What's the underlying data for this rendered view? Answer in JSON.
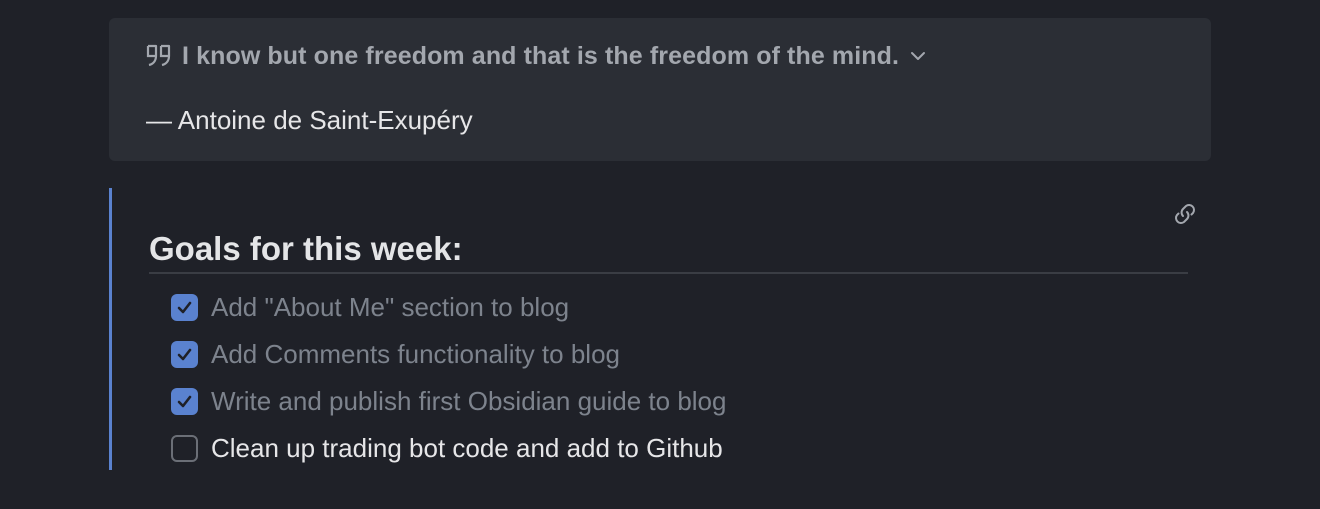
{
  "quote": {
    "icon": "quote-icon",
    "text": "I know but one freedom and that is the freedom of the mind.",
    "author": "— Antoine de Saint-Exupéry"
  },
  "goals": {
    "heading": "Goals for this week:",
    "tasks": [
      {
        "label": "Add \"About Me\" section to blog",
        "checked": true
      },
      {
        "label": "Add Comments functionality to blog",
        "checked": true
      },
      {
        "label": "Write and publish first Obsidian guide to blog",
        "checked": true
      },
      {
        "label": "Clean up trading bot code and add to Github",
        "checked": false
      }
    ]
  },
  "colors": {
    "background": "#1f2128",
    "callout_bg": "#2b2e35",
    "accent": "#5a82cf",
    "done_text": "#7d838d"
  }
}
